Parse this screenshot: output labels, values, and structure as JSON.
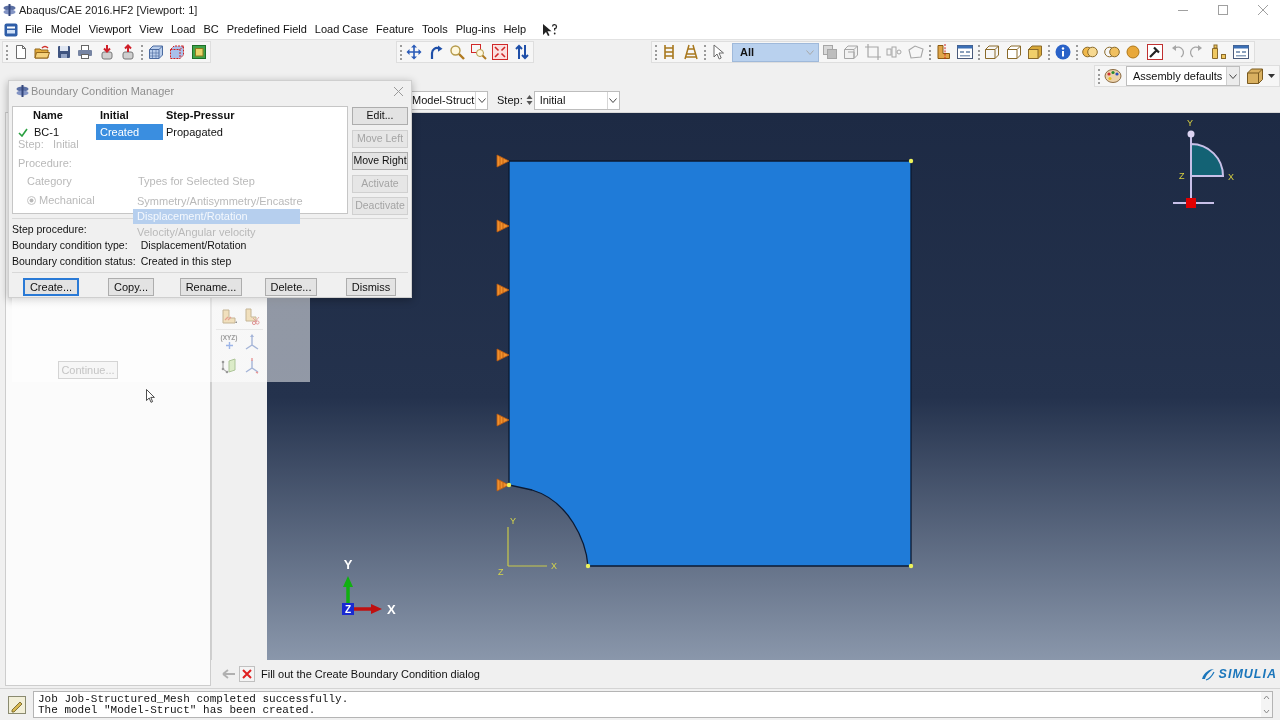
{
  "window": {
    "title": "Abaqus/CAE 2016.HF2 [Viewport: 1]"
  },
  "menu_bar": {
    "items": [
      "File",
      "Model",
      "Viewport",
      "View",
      "Load",
      "BC",
      "Predefined Field",
      "Load Case",
      "Feature",
      "Tools",
      "Plug-ins",
      "Help"
    ]
  },
  "toolbar": {
    "selection_filter": "All",
    "render_style": "Assembly defaults"
  },
  "context_bar": {
    "model": "Model-Struct",
    "step_label": "Step:",
    "step": "Initial"
  },
  "bc_manager": {
    "title": "Boundary Condition Manager",
    "columns": [
      "Name",
      "Initial",
      "Step-Pressur"
    ],
    "rows": [
      {
        "active": true,
        "cells": [
          {
            "text": "BC-1",
            "selected": false
          },
          {
            "text": "Created",
            "selected": true
          },
          {
            "text": "Propagated",
            "selected": false
          }
        ]
      }
    ],
    "side_buttons": [
      {
        "label": "Edit...",
        "disabled": false
      },
      {
        "label": "Move Left",
        "disabled": true
      },
      {
        "label": "Move Right",
        "disabled": false
      },
      {
        "label": "Activate",
        "disabled": true
      },
      {
        "label": "Deactivate",
        "disabled": true
      }
    ],
    "details": [
      {
        "label": "Step procedure:"
      },
      {
        "label": "Boundary condition type:",
        "value": "Displacement/Rotation"
      },
      {
        "label": "Boundary condition status:",
        "value": "Created in this step"
      }
    ],
    "bottom_buttons": [
      {
        "label": "Create...",
        "focused": true
      },
      {
        "label": "Copy...",
        "focused": false
      },
      {
        "label": "Rename...",
        "focused": false
      },
      {
        "label": "Delete...",
        "focused": false
      },
      {
        "label": "Dismiss",
        "focused": false
      }
    ]
  },
  "create_dialog": {
    "step_label": "Step:",
    "step_value": "Initial",
    "procedure_label": "Procedure:",
    "category_label": "Category",
    "categories": [
      {
        "label": "Mechanical",
        "selected": true
      }
    ],
    "types_label": "Types for Selected Step",
    "types": [
      {
        "label": "Symmetry/Antisymmetry/Encastre",
        "selected": false
      },
      {
        "label": "Displacement/Rotation",
        "selected": true
      },
      {
        "label": "Velocity/Angular velocity",
        "selected": false
      }
    ],
    "continue_button": "Continue..."
  },
  "toolbox": {
    "datum_label": "(XYZ)"
  },
  "viewport": {
    "part_csys": {
      "x": "X",
      "y": "Y",
      "z": "Z"
    },
    "global_triad": {
      "x": "X",
      "y": "Y",
      "z": "Z"
    },
    "view_triad": {
      "x": "X",
      "y": "Y",
      "z": "Z"
    }
  },
  "prompt": {
    "back_disabled": true,
    "text": "Fill out the Create Boundary Condition dialog"
  },
  "brand": {
    "name": "SIMULIA"
  },
  "message_area": {
    "lines": [
      "Job Job-Structured_Mesh completed successfully.",
      "The model \"Model-Struct\" has been created."
    ]
  }
}
